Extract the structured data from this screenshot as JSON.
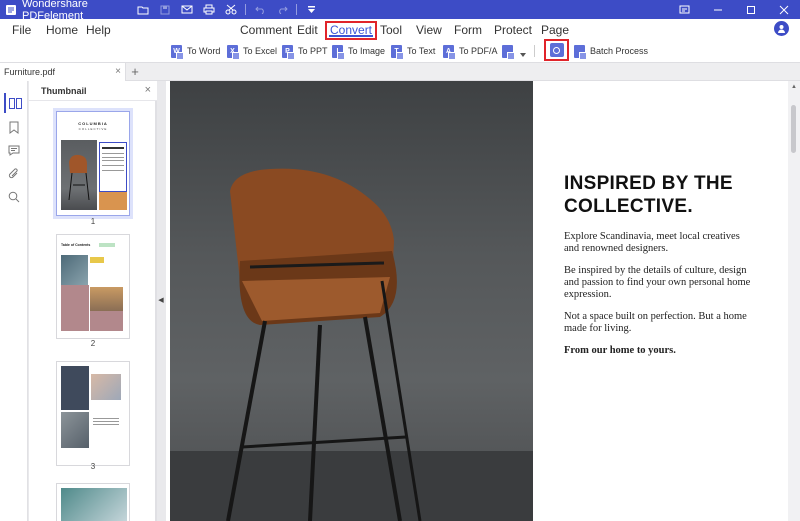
{
  "app": {
    "title": "Wondershare PDFelement",
    "brand_color": "#3d4cc6",
    "highlight_color": "#e0242a"
  },
  "quick_access": [
    {
      "icon": "folder-icon"
    },
    {
      "icon": "save-icon"
    },
    {
      "icon": "email-icon"
    },
    {
      "icon": "print-icon"
    },
    {
      "icon": "cut-icon"
    },
    {
      "icon": "undo-icon"
    },
    {
      "icon": "redo-icon"
    },
    {
      "icon": "customize-dropdown-icon"
    }
  ],
  "window_controls": [
    {
      "icon": "feedback-icon"
    },
    {
      "icon": "minimize-icon"
    },
    {
      "icon": "maximize-icon"
    },
    {
      "icon": "close-icon"
    }
  ],
  "menubar": {
    "left": [
      "File",
      "Home",
      "Help"
    ],
    "tabs": [
      "Comment",
      "Edit",
      "Convert",
      "Tool",
      "View",
      "Form",
      "Protect",
      "Page"
    ],
    "active_tab": "Convert",
    "user_icon": "user-icon"
  },
  "ribbon": {
    "buttons": [
      {
        "label": "To Word",
        "glyph": "W"
      },
      {
        "label": "To Excel",
        "glyph": "X"
      },
      {
        "label": "To PPT",
        "glyph": "P"
      },
      {
        "label": "To Image",
        "glyph": "I"
      },
      {
        "label": "To Text",
        "glyph": "T"
      },
      {
        "label": "To PDF/A",
        "glyph": "A"
      }
    ],
    "more_icon": "more-formats-icon",
    "ocr_icon": "ocr-icon",
    "batch_label": "Batch Process"
  },
  "doc_tabs": {
    "file_name": "Furniture.pdf",
    "close_glyph": "×",
    "new_tab_glyph": "+"
  },
  "left_rail": [
    {
      "icon": "thumbnail-icon",
      "active": true
    },
    {
      "icon": "bookmark-icon",
      "active": false
    },
    {
      "icon": "comment-icon",
      "active": false
    },
    {
      "icon": "attachment-icon",
      "active": false
    },
    {
      "icon": "search-icon",
      "active": false
    }
  ],
  "thumbnail_panel": {
    "title": "Thumbnail",
    "close_glyph": "×",
    "pages": [
      "1",
      "2",
      "3"
    ],
    "selected_page": "1",
    "page1_heading": "COLUMBIA",
    "page1_sub": "COLLECTIVE",
    "page2_heading": "Table of Contents"
  },
  "document": {
    "headline": "INSPIRED BY THE COLLECTIVE.",
    "paragraphs": [
      "Explore Scandinavia, meet local creatives and renowned designers.",
      "Be inspired by the details of culture, design and passion to find your own personal home expression.",
      "Not a space built on perfection. But a home made for living."
    ],
    "closing": "From our home to yours."
  }
}
